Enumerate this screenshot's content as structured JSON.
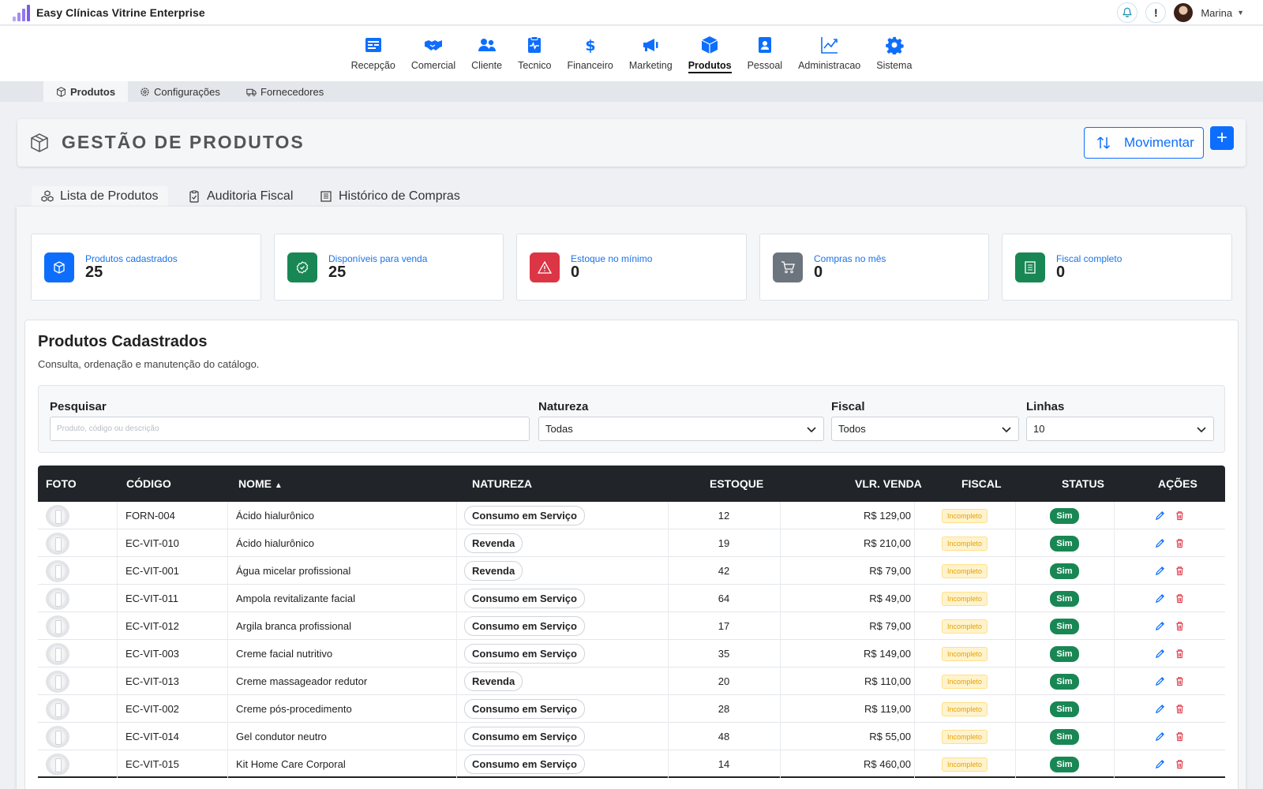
{
  "app": {
    "title": "Easy Clínicas Vitrine Enterprise"
  },
  "topbar": {
    "user_name": "Marina",
    "notifications_icon": "bell-icon",
    "alert_label": "!"
  },
  "modules": [
    {
      "label": "Recepção",
      "icon": "reception-icon"
    },
    {
      "label": "Comercial",
      "icon": "handshake-icon"
    },
    {
      "label": "Cliente",
      "icon": "users-icon"
    },
    {
      "label": "Tecnico",
      "icon": "clipboard-pulse-icon"
    },
    {
      "label": "Financeiro",
      "icon": "dollar-icon"
    },
    {
      "label": "Marketing",
      "icon": "megaphone-icon"
    },
    {
      "label": "Produtos",
      "icon": "box-icon",
      "active": true
    },
    {
      "label": "Pessoal",
      "icon": "id-badge-icon"
    },
    {
      "label": "Administracao",
      "icon": "chart-line-icon"
    },
    {
      "label": "Sistema",
      "icon": "gear-icon"
    }
  ],
  "subnav": [
    {
      "label": "Produtos",
      "icon": "box-icon",
      "active": true
    },
    {
      "label": "Configurações",
      "icon": "gear-icon"
    },
    {
      "label": "Fornecedores",
      "icon": "truck-icon"
    }
  ],
  "header": {
    "title": "GESTÃO DE PRODUTOS",
    "move_button": "Movimentar",
    "add_button": "+"
  },
  "tabs": [
    {
      "label": "Lista de Produtos",
      "icon": "cubes-icon",
      "active": true
    },
    {
      "label": "Auditoria Fiscal",
      "icon": "clipboard-check-icon"
    },
    {
      "label": "Histórico de Compras",
      "icon": "receipt-icon"
    }
  ],
  "stats": [
    {
      "label": "Produtos cadastrados",
      "value": "25",
      "color": "#0d6efd",
      "icon": "box-icon"
    },
    {
      "label": "Disponíveis para venda",
      "value": "25",
      "color": "#198754",
      "icon": "check-circle-icon"
    },
    {
      "label": "Estoque no mínimo",
      "value": "0",
      "color": "#dc3545",
      "icon": "warning-icon"
    },
    {
      "label": "Compras no mês",
      "value": "0",
      "color": "#6c757d",
      "icon": "cart-icon"
    },
    {
      "label": "Fiscal completo",
      "value": "0",
      "color": "#198754",
      "icon": "document-icon"
    }
  ],
  "section": {
    "title": "Produtos Cadastrados",
    "subtitle": "Consulta, ordenação e manutenção do catálogo."
  },
  "filters": {
    "search_label": "Pesquisar",
    "search_placeholder": "Produto, código ou descrição",
    "natureza_label": "Natureza",
    "natureza_value": "Todas",
    "fiscal_label": "Fiscal",
    "fiscal_value": "Todos",
    "linhas_label": "Linhas",
    "linhas_value": "10"
  },
  "table": {
    "columns": {
      "foto": "FOTO",
      "codigo": "CÓDIGO",
      "nome": "NOME",
      "natureza": "NATUREZA",
      "estoque": "ESTOQUE",
      "venda": "VLR. VENDA",
      "fiscal": "FISCAL",
      "status": "STATUS",
      "acoes": "AÇÕES"
    },
    "rows": [
      {
        "codigo": "FORN-004",
        "nome": "Ácido hialurônico",
        "natureza": "Consumo em Serviço",
        "estoque": "12",
        "venda": "R$ 129,00",
        "fiscal": "Incompleto",
        "status": "Sim"
      },
      {
        "codigo": "EC-VIT-010",
        "nome": "Ácido hialurônico",
        "natureza": "Revenda",
        "estoque": "19",
        "venda": "R$ 210,00",
        "fiscal": "Incompleto",
        "status": "Sim"
      },
      {
        "codigo": "EC-VIT-001",
        "nome": "Água micelar profissional",
        "natureza": "Revenda",
        "estoque": "42",
        "venda": "R$ 79,00",
        "fiscal": "Incompleto",
        "status": "Sim"
      },
      {
        "codigo": "EC-VIT-011",
        "nome": "Ampola revitalizante facial",
        "natureza": "Consumo em Serviço",
        "estoque": "64",
        "venda": "R$ 49,00",
        "fiscal": "Incompleto",
        "status": "Sim"
      },
      {
        "codigo": "EC-VIT-012",
        "nome": "Argila branca profissional",
        "natureza": "Consumo em Serviço",
        "estoque": "17",
        "venda": "R$ 79,00",
        "fiscal": "Incompleto",
        "status": "Sim"
      },
      {
        "codigo": "EC-VIT-003",
        "nome": "Creme facial nutritivo",
        "natureza": "Consumo em Serviço",
        "estoque": "35",
        "venda": "R$ 149,00",
        "fiscal": "Incompleto",
        "status": "Sim"
      },
      {
        "codigo": "EC-VIT-013",
        "nome": "Creme massageador redutor",
        "natureza": "Revenda",
        "estoque": "20",
        "venda": "R$ 110,00",
        "fiscal": "Incompleto",
        "status": "Sim"
      },
      {
        "codigo": "EC-VIT-002",
        "nome": "Creme pós-procedimento",
        "natureza": "Consumo em Serviço",
        "estoque": "28",
        "venda": "R$ 119,00",
        "fiscal": "Incompleto",
        "status": "Sim"
      },
      {
        "codigo": "EC-VIT-014",
        "nome": "Gel condutor neutro",
        "natureza": "Consumo em Serviço",
        "estoque": "48",
        "venda": "R$ 55,00",
        "fiscal": "Incompleto",
        "status": "Sim"
      },
      {
        "codigo": "EC-VIT-015",
        "nome": "Kit Home Care Corporal",
        "natureza": "Consumo em Serviço",
        "estoque": "14",
        "venda": "R$ 460,00",
        "fiscal": "Incompleto",
        "status": "Sim"
      }
    ]
  },
  "colors": {
    "primary": "#0d6efd",
    "success": "#198754",
    "danger": "#dc3545",
    "secondary": "#6c757d",
    "dark": "#212529",
    "brand": "#8c6cf0"
  }
}
